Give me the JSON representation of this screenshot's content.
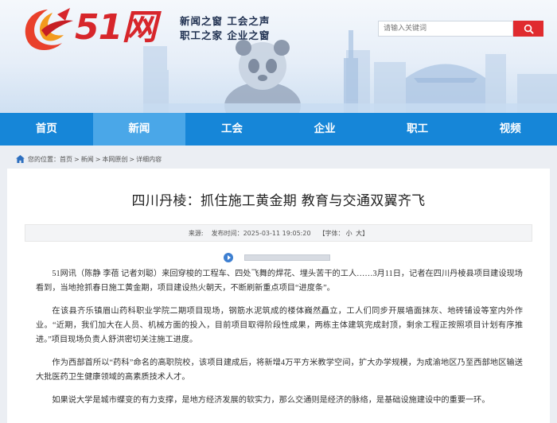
{
  "header": {
    "logo_text": "51网",
    "slogan_line1": "新闻之窗  工会之声",
    "slogan_line2": "职工之家  企业之窗",
    "search_placeholder": "请输入关键词"
  },
  "nav": {
    "items": [
      {
        "label": "首页"
      },
      {
        "label": "新闻"
      },
      {
        "label": "工会"
      },
      {
        "label": "企业"
      },
      {
        "label": "职工"
      },
      {
        "label": "视频"
      }
    ],
    "active_index": 1
  },
  "breadcrumb": {
    "prefix": "您的位置：",
    "items": [
      "首页",
      "新闻",
      "本网原创",
      "详细内容"
    ],
    "separator": ">"
  },
  "article": {
    "title": "四川丹棱：抓住施工黄金期 教育与交通双翼齐飞",
    "source_label": "来源:",
    "publish_label": "发布时间：",
    "publish_time": "2025-03-11 19:05:20",
    "font_size_label": "【字体：",
    "font_small": "小",
    "font_large": "大",
    "font_close": "】",
    "paragraphs": [
      "51网讯（陈静 李蓓 记者刘聪）来回穿梭的工程车、四处飞舞的焊花、埋头苦干的工人……3月11日，记者在四川丹棱县项目建设现场看到，当地抢抓春日施工黄金期，项目建设热火朝天，不断刷新重点项目“进度条”。",
      "在该县齐乐镇眉山药科职业学院二期项目现场，钢筋水泥筑成的楼体巍然矗立，工人们同步开展墙面抹灰、地砖铺设等室内外作业。“近期，我们加大在人员、机械方面的投入，目前项目取得阶段性成果，两栋主体建筑完成封顶，剩余工程正按照项目计划有序推进。”项目现场负责人舒洪密切关注施工进度。",
      "作为西部首所以“药科”命名的高职院校，该项目建成后，将新增4万平方米教学空间，扩大办学规模，为成渝地区乃至西部地区输送大批医药卫生健康领域的高素质技术人才。",
      "如果说大学是城市蝶变的有力支撑，是地方经济发展的软实力，那么交通则是经济的脉络，是基础设施建设中的重要一环。"
    ]
  },
  "colors": {
    "brand_red": "#d7262b",
    "nav_blue": "#1686d8",
    "nav_active": "#4aa7e8",
    "search_red": "#e02b2f"
  },
  "icons": {
    "home": "home-icon",
    "search": "search-icon",
    "play": "play-icon",
    "logo": "phoenix-logo-icon"
  }
}
